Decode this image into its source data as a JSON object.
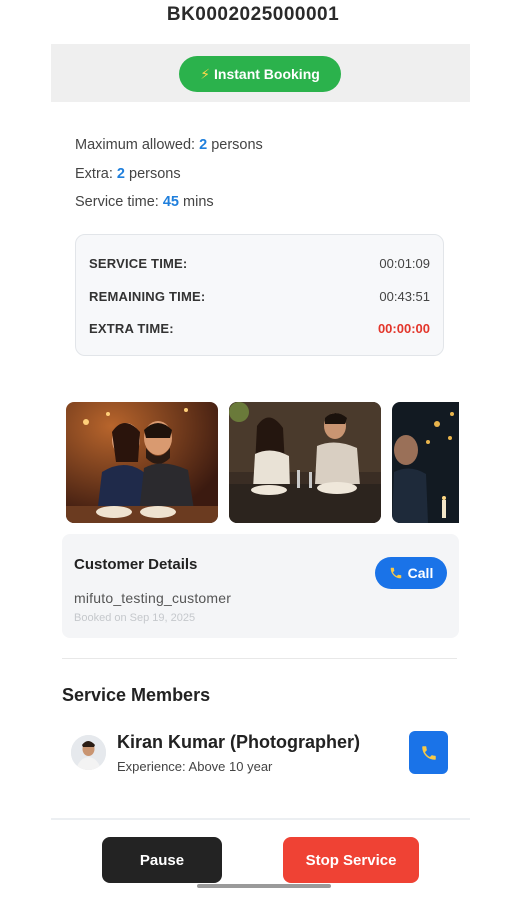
{
  "booking": {
    "id": "BK0002025000001"
  },
  "badge": {
    "icon": "lightning-icon",
    "label": "Instant Booking",
    "color": "#2bb24c"
  },
  "limits": {
    "max_prefix": "Maximum allowed: ",
    "max_value": "2",
    "max_suffix": " persons",
    "extra_prefix": "Extra: ",
    "extra_value": "2",
    "extra_suffix": " persons",
    "service_prefix": "Service time: ",
    "service_value": "45",
    "service_suffix": " mins"
  },
  "timers": [
    {
      "label": "SERVICE TIME:",
      "value": "00:01:09"
    },
    {
      "label": "REMAINING TIME:",
      "value": "00:43:51"
    },
    {
      "label": "EXTRA TIME:",
      "value": "00:00:00"
    }
  ],
  "customer": {
    "title": "Customer Details",
    "name": "mifuto_testing_customer",
    "booked_on": "Booked on Sep 19, 2025",
    "call_label": "Call",
    "call_icon": "phone-icon"
  },
  "members": {
    "title": "Service Members",
    "items": [
      {
        "name": "Kiran Kumar (Photographer)",
        "experience": "Experience: Above 10 year",
        "icon": "phone-icon"
      }
    ]
  },
  "actions": {
    "pause_label": "Pause",
    "stop_label": "Stop Service"
  },
  "colors": {
    "accent": "#1a73e8",
    "number": "#1f7fdc",
    "danger": "#ef4234",
    "success": "#2bb24c"
  }
}
